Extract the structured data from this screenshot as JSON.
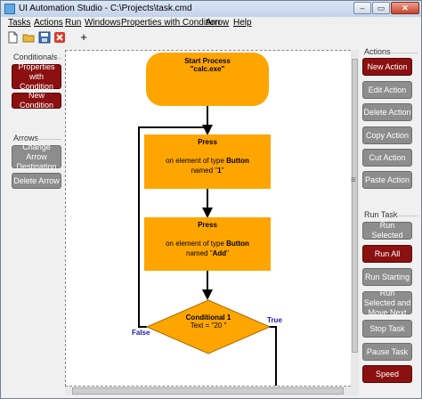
{
  "window": {
    "title": "UI Automation Studio - C:\\Projects\\task.cmd",
    "minimize": "–",
    "maximize": "▭",
    "close": "✕"
  },
  "menu": [
    {
      "label": "Tasks",
      "key": "T"
    },
    {
      "label": "Actions",
      "key": "A"
    },
    {
      "label": "Run",
      "key": "R"
    },
    {
      "label": "Windows",
      "key": "W"
    },
    {
      "label": "Properties with Condition",
      "key": "P"
    },
    {
      "label": "Arrow",
      "key": "A"
    },
    {
      "label": "Help",
      "key": "H"
    }
  ],
  "toolbar": {
    "plus": "+"
  },
  "left_panel": {
    "conditionals": {
      "label": "Conditionals",
      "buttons": [
        "Properties with Condition",
        "New Condition"
      ]
    },
    "arrows": {
      "label": "Arrows",
      "buttons": [
        "Change Arrow Destination",
        "Delete Arrow"
      ]
    }
  },
  "right_panel": {
    "actions": {
      "label": "Actions",
      "buttons": [
        "New Action",
        "Edit Action",
        "Delete Action",
        "Copy Action",
        "Cut Action",
        "Paste Action"
      ]
    },
    "run_task": {
      "label": "Run Task",
      "buttons": [
        "Run Selected",
        "Run All",
        "Run Starting",
        "Run Selected and Move Next",
        "Stop Task",
        "Pause Task",
        "Speed"
      ]
    }
  },
  "flow": {
    "start": {
      "title": "Start Process",
      "detail": "\"calc.exe\""
    },
    "press1": {
      "title": "Press",
      "line1_pre": "on element of type ",
      "line1_bold": "Button",
      "line2_pre": "named \"",
      "line2_bold": "1",
      "line2_post": "\""
    },
    "press2": {
      "title": "Press",
      "line1_pre": "on element of type ",
      "line1_bold": "Button",
      "line2_pre": "named \"",
      "line2_bold": "Add",
      "line2_post": "\""
    },
    "conditional": {
      "title": "Conditional 1",
      "detail": "Text = \"20 \""
    },
    "false_label": "False",
    "true_label": "True"
  },
  "colors": {
    "node": "#ffa500",
    "button_red": "#8b1010",
    "button_gray": "#8d8d8d",
    "connector_label": "#1a1aaa"
  },
  "icons": [
    "app-icon",
    "new-file-icon",
    "open-folder-icon",
    "save-icon",
    "delete-icon",
    "add-icon",
    "splitter-grip-icon"
  ]
}
